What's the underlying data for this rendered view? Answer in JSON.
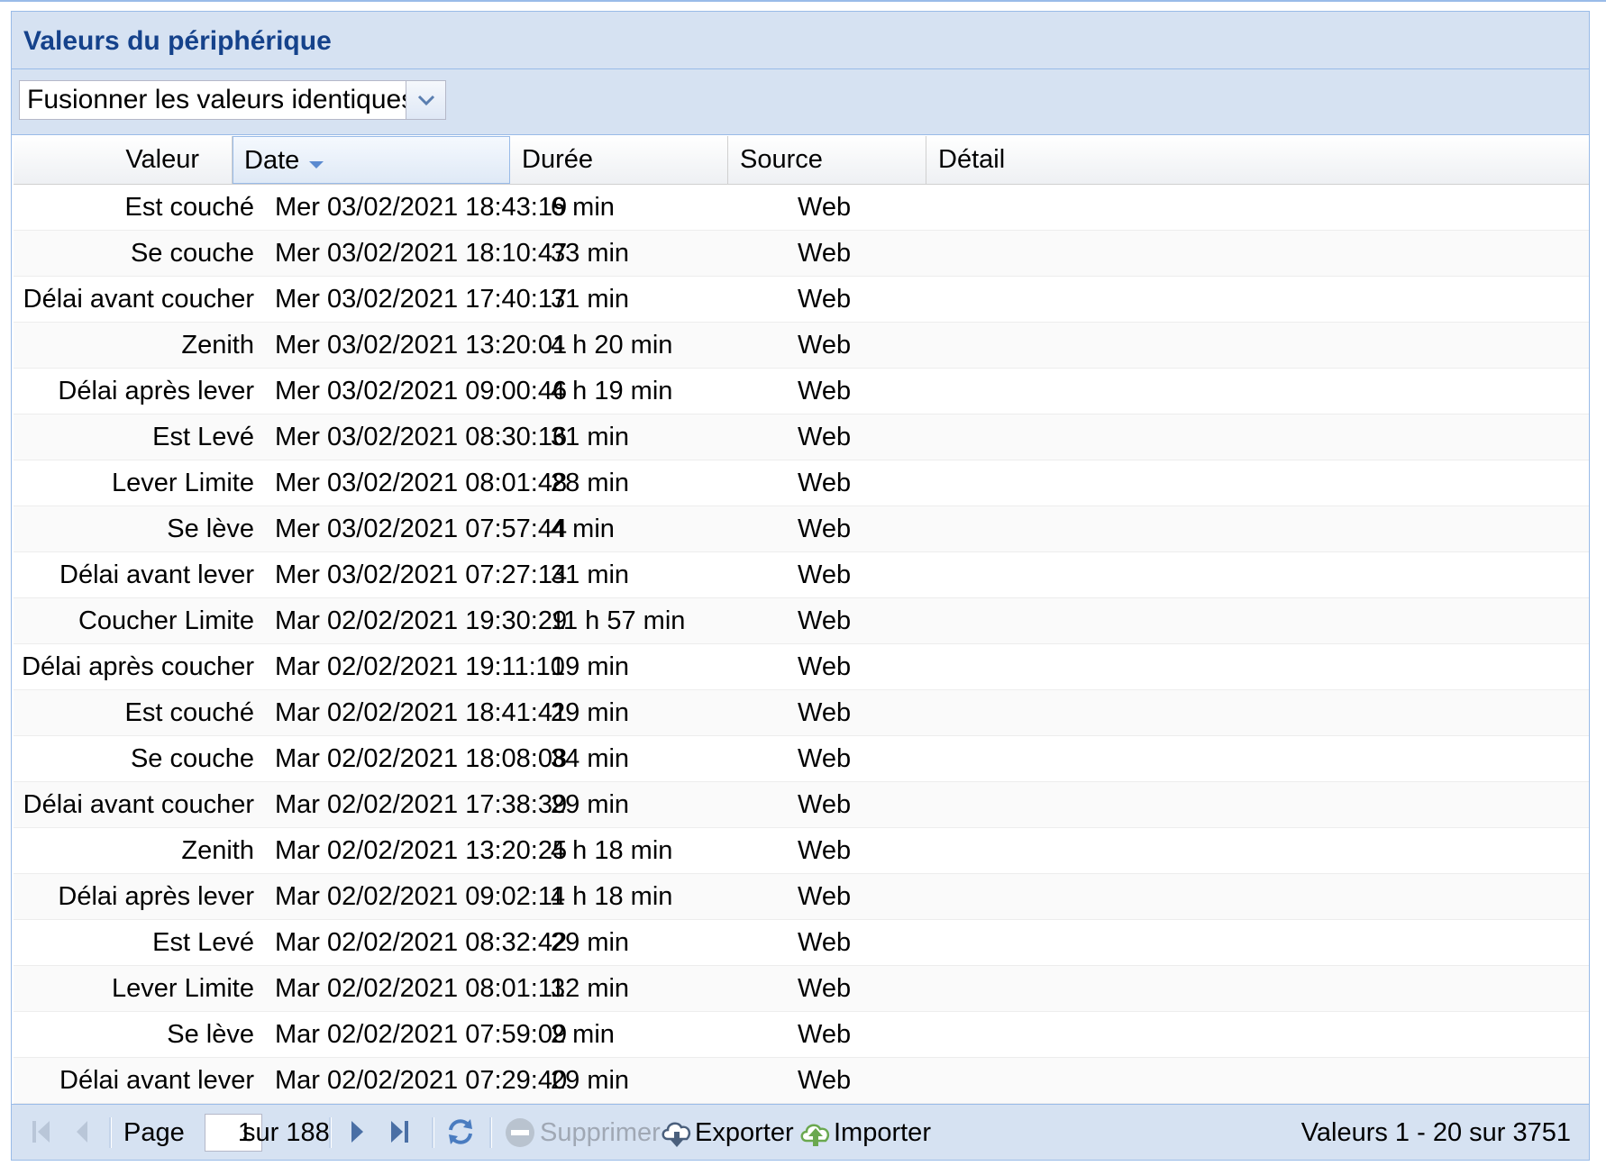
{
  "panel": {
    "title": "Valeurs du périphérique"
  },
  "toolbar": {
    "merge_select_value": "Fusionner les valeurs identiques"
  },
  "columns": {
    "value": "Valeur",
    "date": "Date",
    "duration": "Durée",
    "source": "Source",
    "detail": "Détail"
  },
  "sorted_column": "date",
  "rows": [
    {
      "value": "Est couché",
      "date": "Mer 03/02/2021 18:43:19",
      "duration": "6 min",
      "source": "Web",
      "detail": ""
    },
    {
      "value": "Se couche",
      "date": "Mer 03/02/2021 18:10:47",
      "duration": "33 min",
      "source": "Web",
      "detail": ""
    },
    {
      "value": "Délai avant coucher",
      "date": "Mer 03/02/2021 17:40:17",
      "duration": "31 min",
      "source": "Web",
      "detail": ""
    },
    {
      "value": "Zenith",
      "date": "Mer 03/02/2021 13:20:01",
      "duration": "4 h 20 min",
      "source": "Web",
      "detail": ""
    },
    {
      "value": "Délai après lever",
      "date": "Mer 03/02/2021 09:00:46",
      "duration": "4 h 19 min",
      "source": "Web",
      "detail": ""
    },
    {
      "value": "Est Levé",
      "date": "Mer 03/02/2021 08:30:16",
      "duration": "31 min",
      "source": "Web",
      "detail": ""
    },
    {
      "value": "Lever Limite",
      "date": "Mer 03/02/2021 08:01:48",
      "duration": "28 min",
      "source": "Web",
      "detail": ""
    },
    {
      "value": "Se lève",
      "date": "Mer 03/02/2021 07:57:44",
      "duration": "4 min",
      "source": "Web",
      "detail": ""
    },
    {
      "value": "Délai avant lever",
      "date": "Mer 03/02/2021 07:27:14",
      "duration": "31 min",
      "source": "Web",
      "detail": ""
    },
    {
      "value": "Coucher Limite",
      "date": "Mar 02/02/2021 19:30:29",
      "duration": "11 h 57 min",
      "source": "Web",
      "detail": ""
    },
    {
      "value": "Délai après coucher",
      "date": "Mar 02/02/2021 19:11:10",
      "duration": "19 min",
      "source": "Web",
      "detail": ""
    },
    {
      "value": "Est couché",
      "date": "Mar 02/02/2021 18:41:41",
      "duration": "29 min",
      "source": "Web",
      "detail": ""
    },
    {
      "value": "Se couche",
      "date": "Mar 02/02/2021 18:08:08",
      "duration": "34 min",
      "source": "Web",
      "detail": ""
    },
    {
      "value": "Délai avant coucher",
      "date": "Mar 02/02/2021 17:38:39",
      "duration": "29 min",
      "source": "Web",
      "detail": ""
    },
    {
      "value": "Zenith",
      "date": "Mar 02/02/2021 13:20:25",
      "duration": "4 h 18 min",
      "source": "Web",
      "detail": ""
    },
    {
      "value": "Délai après lever",
      "date": "Mar 02/02/2021 09:02:11",
      "duration": "4 h 18 min",
      "source": "Web",
      "detail": ""
    },
    {
      "value": "Est Levé",
      "date": "Mar 02/02/2021 08:32:42",
      "duration": "29 min",
      "source": "Web",
      "detail": ""
    },
    {
      "value": "Lever Limite",
      "date": "Mar 02/02/2021 08:01:11",
      "duration": "32 min",
      "source": "Web",
      "detail": ""
    },
    {
      "value": "Se lève",
      "date": "Mar 02/02/2021 07:59:09",
      "duration": "2 min",
      "source": "Web",
      "detail": ""
    },
    {
      "value": "Délai avant lever",
      "date": "Mar 02/02/2021 07:29:40",
      "duration": "29 min",
      "source": "Web",
      "detail": ""
    }
  ],
  "pager": {
    "page_label": "Page",
    "page_value": "1",
    "total_label": "sur 188",
    "delete_label": "Supprimer",
    "export_label": "Exporter",
    "import_label": "Importer",
    "summary": "Valeurs 1 - 20 sur 3751"
  },
  "colors": {
    "header_bg": "#d6e2f2",
    "title_color": "#15428b",
    "border": "#99bbe8",
    "import_icon": "#6aa84f"
  },
  "icons": [
    "chevron-down-icon",
    "sort-desc-icon",
    "first-page-icon",
    "prev-page-icon",
    "next-page-icon",
    "last-page-icon",
    "refresh-icon",
    "delete-icon",
    "export-cloud-icon",
    "import-cloud-icon"
  ]
}
